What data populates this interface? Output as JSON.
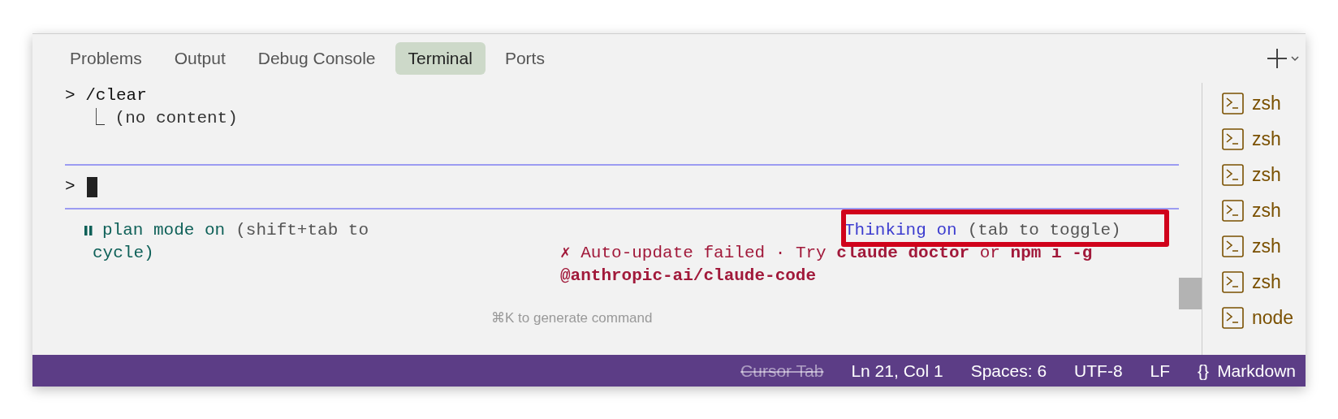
{
  "tabs": [
    {
      "label": "Problems",
      "selected": false
    },
    {
      "label": "Output",
      "selected": false
    },
    {
      "label": "Debug Console",
      "selected": false
    },
    {
      "label": "Terminal",
      "selected": true
    },
    {
      "label": "Ports",
      "selected": false
    }
  ],
  "terminal": {
    "command": "> /clear",
    "result": "⎿ (no content)",
    "prompt": ">",
    "plan_mode": {
      "label": "plan mode on",
      "hint": "(shift+tab to",
      "hint_end": "cycle)"
    },
    "thinking": {
      "label": "Thinking on",
      "hint": "(tab to toggle)"
    },
    "error": "✗ Auto-update failed · Try **claude doctor** or **npm i -g @anthropic-ai/claude-code**",
    "footer_hint": "⌘K to generate command"
  },
  "terminals": [
    {
      "label": "zsh"
    },
    {
      "label": "zsh"
    },
    {
      "label": "zsh"
    },
    {
      "label": "zsh"
    },
    {
      "label": "zsh"
    },
    {
      "label": "zsh"
    },
    {
      "label": "node"
    }
  ],
  "status_bar": [
    {
      "label": "Cursor Tab",
      "disabled": true
    },
    {
      "label": "Ln 21, Col 1",
      "disabled": false
    },
    {
      "label": "Spaces: 6",
      "disabled": false
    },
    {
      "label": "UTF-8",
      "disabled": false
    },
    {
      "label": "LF",
      "disabled": false
    },
    {
      "icon": "{}",
      "label": "Markdown",
      "disabled": false
    }
  ]
}
